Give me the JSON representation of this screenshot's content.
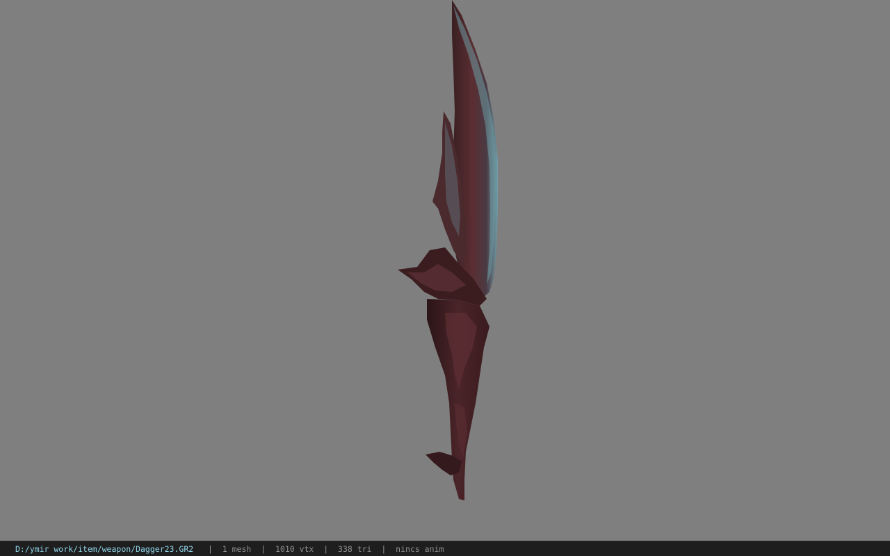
{
  "viewport": {
    "background_color": "#7f7f7f",
    "model_name": "dagger-model"
  },
  "statusbar": {
    "file_path": "D:/ymir work/item/weapon/Dagger23.GR2",
    "separator": "|",
    "meshes": "1 mesh",
    "vertices": "1010 vtx",
    "triangles": "338 tri",
    "animation": "nincs anim",
    "path_color": "#8fd3e8",
    "text_color": "#8f8f8f",
    "background_color": "#1e1e1e"
  }
}
